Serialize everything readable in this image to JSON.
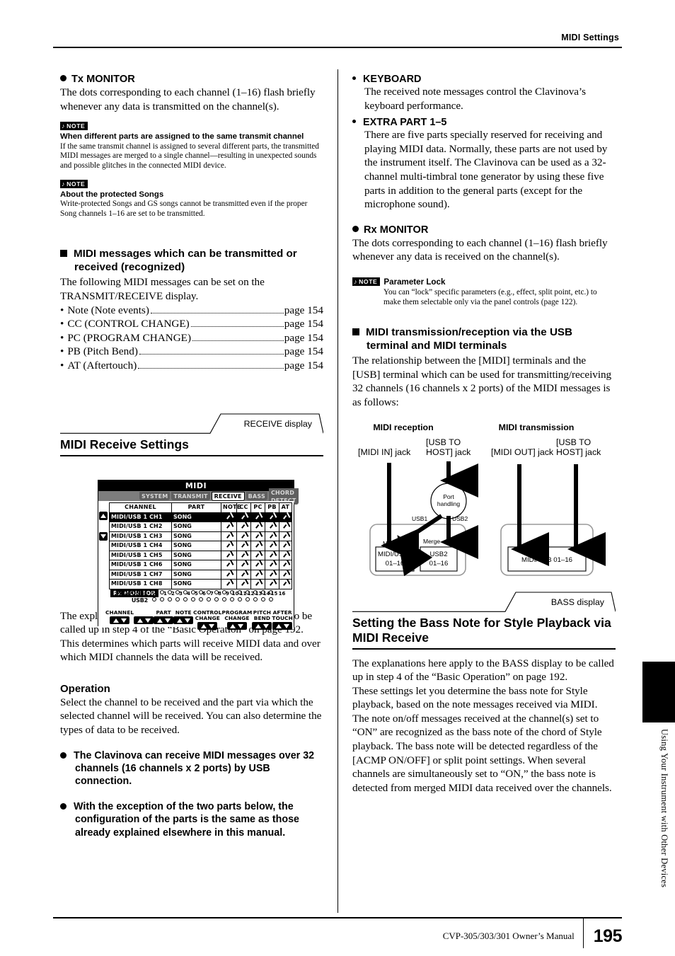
{
  "header": {
    "title": "MIDI Settings"
  },
  "footer": {
    "manual": "CVP-305/303/301 Owner’s Manual",
    "page": "195"
  },
  "edge_tab": {
    "label": "Using Your Instrument with Other Devices"
  },
  "left": {
    "tx_monitor": {
      "heading": "Tx MONITOR",
      "body": "The dots corresponding to each channel (1–16) flash briefly whenever any data is transmitted on the channel(s)."
    },
    "note1": {
      "badge": "NOTE",
      "title": "When different parts are assigned to the same transmit channel",
      "body": "If the same transmit channel is assigned to several different parts, the transmitted MIDI messages are merged to a single channel—resulting in unexpected sounds and possible glitches in the connected MIDI device."
    },
    "note2": {
      "badge": "NOTE",
      "title": "About the protected Songs",
      "body": "Write-protected Songs and GS songs cannot be transmitted even if the proper Song channels 1–16 are set to be transmitted."
    },
    "messages": {
      "heading": "MIDI messages which can be transmitted or received (recognized)",
      "body": "The following MIDI messages can be set on the TRANSMIT/RECEIVE display.",
      "items": [
        {
          "label": "Note (Note events)",
          "page": "page 154"
        },
        {
          "label": "CC (CONTROL CHANGE)",
          "page": "page 154"
        },
        {
          "label": "PC (PROGRAM CHANGE)",
          "page": "page 154"
        },
        {
          "label": "PB (Pitch Bend)",
          "page": "page 154"
        },
        {
          "label": "AT (Aftertouch)",
          "page": "page 154"
        }
      ]
    },
    "receive_section": {
      "callout": "RECEIVE display",
      "title": "MIDI Receive Settings",
      "body": "The explanations here apply to the RECEIVE display to be called up in step 4 of the “Basic Operation” on page 192. This determines which parts will receive MIDI data and over which MIDI channels the data will be received."
    },
    "operation": {
      "heading": "Operation",
      "body": "Select the channel to be received and the part via which the selected channel will be received. You can also determine the types of data to be received.",
      "bullets": [
        "The Clavinova can receive MIDI messages over 32 channels (16 channels x 2 ports) by USB connection.",
        "With the exception of the two parts below, the configuration of the parts is the same as those already explained elsewhere in this manual."
      ]
    }
  },
  "right": {
    "keyboard": {
      "title": "KEYBOARD",
      "body": "The received note messages control the Clavinova’s keyboard performance."
    },
    "extra_part": {
      "title": "EXTRA PART 1–5",
      "body": "There are five parts specially reserved for receiving and playing MIDI data. Normally, these parts are not used by the instrument itself. The Clavinova can be used as a 32-channel multi-timbral tone generator by using these five parts in addition to the general parts (except for the microphone sound)."
    },
    "rx_monitor": {
      "heading": "Rx MONITOR",
      "body": "The dots corresponding to each channel (1–16) flash briefly whenever any data is received on the channel(s)."
    },
    "note_param_lock": {
      "badge": "NOTE",
      "title": "Parameter Lock",
      "body": "You can “lock” specific parameters (e.g., effect, split point, etc.) to make them selectable only via the panel controls (page 122)."
    },
    "usb_section": {
      "heading": "MIDI transmission/reception via the USB terminal and MIDI terminals",
      "body": "The relationship between the [MIDI] terminals and the [USB] terminal which can be used for transmitting/receiving 32 channels (16 channels x 2 ports) of the MIDI messages is as follows:"
    },
    "bass_section": {
      "callout": "BASS display",
      "title": "Setting the Bass Note for Style Playback via MIDI Receive",
      "body": "The explanations here apply to the BASS display to be called up in step 4 of the “Basic Operation” on page 192.\nThese settings let you determine the bass note for Style playback, based on the note messages received via MIDI. The note on/off messages received at the channel(s) set to “ON” are recognized as the bass note of the chord of Style playback. The bass note will be detected regardless of the [ACMP ON/OFF] or split point settings. When several channels are simultaneously set to “ON,” the bass note is detected from merged MIDI data received over the channels."
    }
  },
  "lcd": {
    "title": "MIDI",
    "tabs": [
      {
        "label": "SYSTEM",
        "active": false
      },
      {
        "label": "TRANSMIT",
        "active": false
      },
      {
        "label": "RECEIVE",
        "active": true
      },
      {
        "label": "BASS",
        "active": false
      },
      {
        "label": "CHORD DETECT",
        "active": false
      }
    ],
    "columns": [
      "CHANNEL",
      "PART",
      "NOTE",
      "CC",
      "PC",
      "PB",
      "AT"
    ],
    "rows": [
      {
        "channel": "MIDI/USB 1 CH1",
        "part": "SONG",
        "checks": [
          true,
          true,
          true,
          true,
          true
        ],
        "selected": true
      },
      {
        "channel": "MIDI/USB 1 CH2",
        "part": "SONG",
        "checks": [
          true,
          true,
          true,
          true,
          true
        ],
        "selected": false
      },
      {
        "channel": "MIDI/USB 1 CH3",
        "part": "SONG",
        "checks": [
          true,
          true,
          true,
          true,
          true
        ],
        "selected": false
      },
      {
        "channel": "MIDI/USB 1 CH4",
        "part": "SONG",
        "checks": [
          true,
          true,
          true,
          true,
          true
        ],
        "selected": false
      },
      {
        "channel": "MIDI/USB 1 CH5",
        "part": "SONG",
        "checks": [
          true,
          true,
          true,
          true,
          true
        ],
        "selected": false
      },
      {
        "channel": "MIDI/USB 1 CH6",
        "part": "SONG",
        "checks": [
          true,
          true,
          true,
          true,
          true
        ],
        "selected": false
      },
      {
        "channel": "MIDI/USB 1 CH7",
        "part": "SONG",
        "checks": [
          true,
          true,
          true,
          true,
          true
        ],
        "selected": false
      },
      {
        "channel": "MIDI/USB 1 CH8",
        "part": "SONG",
        "checks": [
          true,
          true,
          true,
          true,
          true
        ],
        "selected": false
      }
    ],
    "monitor": {
      "label": "Rx MONITOR",
      "channel_numbers": [
        "1",
        "2",
        "3",
        "4",
        "5",
        "6",
        "7",
        "8",
        "9",
        "10",
        "11",
        "12",
        "13",
        "14",
        "15",
        "16"
      ],
      "rows": [
        {
          "name": "MIDI/USB1"
        },
        {
          "name": "USB2"
        }
      ]
    },
    "footer_buttons": [
      {
        "label": "CHANNEL"
      },
      {
        "label": ""
      },
      {
        "label": "PART"
      },
      {
        "label": "NOTE"
      },
      {
        "label": "CONTROL CHANGE"
      },
      {
        "label": "PROGRAM CHANGE"
      },
      {
        "label": "PITCH BEND"
      },
      {
        "label": "AFTER TOUCH"
      }
    ]
  },
  "diagram": {
    "reception_title": "MIDI reception",
    "transmission_title": "MIDI transmission",
    "midi_in_label": "[MIDI IN] jack",
    "usb_host_in_label": "[USB TO HOST] jack",
    "midi_out_label": "[MIDI OUT] jack",
    "usb_host_out_label": "[USB TO HOST] jack",
    "port_handling": "Port handling",
    "usb1": "USB1",
    "usb2": "USB2",
    "merge": "Merge",
    "box_midi_usb1": "MIDI/USB1 01–16",
    "box_usb2": "USB2 01–16",
    "box_tx": "MIDI/USB 01–16"
  }
}
